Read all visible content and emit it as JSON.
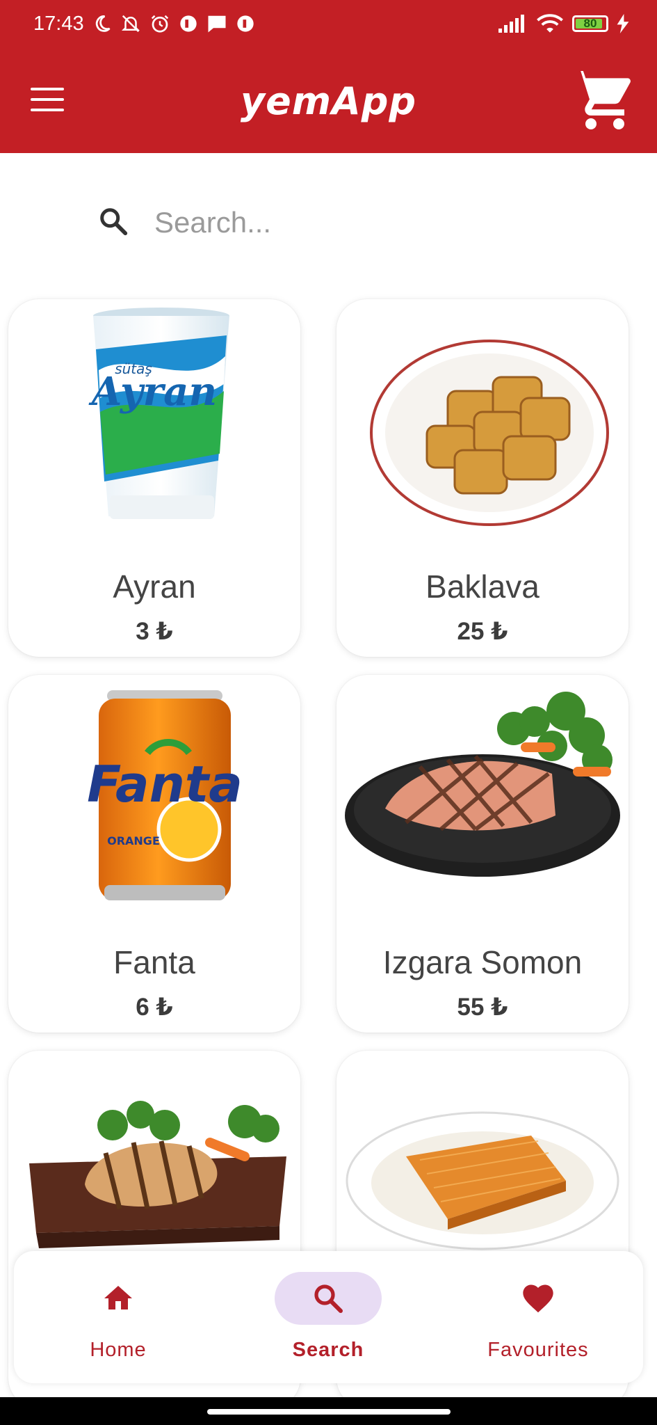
{
  "status_bar": {
    "time": "17:43",
    "battery": "80",
    "icons": [
      "moon-icon",
      "notifications-off-icon",
      "alarm-icon",
      "app-notification-icon",
      "message-icon",
      "app-notification-icon",
      "signal-icon",
      "wifi-icon",
      "battery-icon",
      "charging-icon"
    ]
  },
  "app_bar": {
    "title": "yemApp",
    "menu_icon": "hamburger-menu-icon",
    "cart_icon": "shopping-cart-icon",
    "color": "#c31f25"
  },
  "search": {
    "placeholder": "Search...",
    "icon": "search-icon"
  },
  "products": [
    {
      "name": "Ayran",
      "price": "3 ₺",
      "image": "ayran-cup-image"
    },
    {
      "name": "Baklava",
      "price": "25 ₺",
      "image": "baklava-plate-image"
    },
    {
      "name": "Fanta",
      "price": "6 ₺",
      "image": "fanta-can-image"
    },
    {
      "name": "Izgara Somon",
      "price": "55 ₺",
      "image": "grilled-salmon-image"
    },
    {
      "name": "",
      "price": "",
      "image": "grilled-chicken-image"
    },
    {
      "name": "",
      "price": "",
      "image": "kunefe-plate-image"
    }
  ],
  "bottom_nav": {
    "items": [
      {
        "label": "Home",
        "icon": "home-icon",
        "active": false
      },
      {
        "label": "Search",
        "icon": "search-icon",
        "active": true
      },
      {
        "label": "Favourites",
        "icon": "heart-icon",
        "active": false
      }
    ],
    "accent": "#b3202a",
    "active_pill": "#e8dcf4"
  }
}
